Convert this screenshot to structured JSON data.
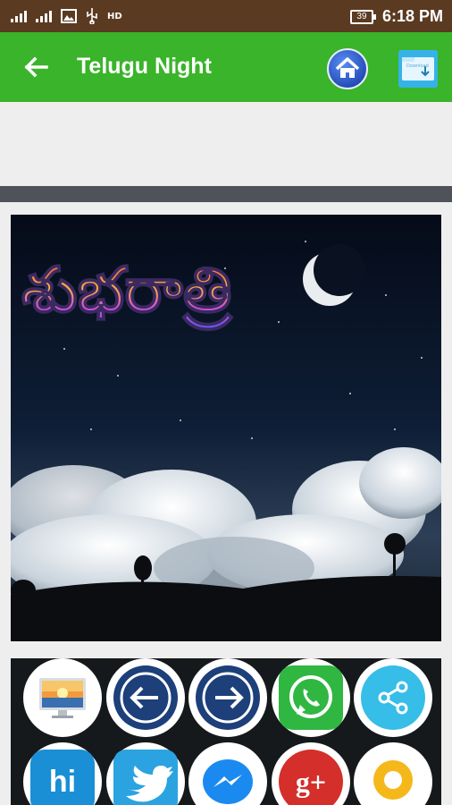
{
  "status_bar": {
    "hd_label": "HD",
    "battery": "39",
    "time": "6:18 PM"
  },
  "app_bar": {
    "title": "Telugu Night",
    "back_icon": "arrow-left-icon",
    "home_icon": "home-icon",
    "download_icon": "download-folder-icon",
    "download_caption": "Download"
  },
  "image": {
    "overlay_text": "శుభరాత్రి",
    "description_icons": [
      "crescent-moon",
      "clouds",
      "trees"
    ]
  },
  "share_buttons": [
    {
      "name": "set-wallpaper",
      "icon": "monitor-sunset-icon"
    },
    {
      "name": "previous",
      "icon": "arrow-left-circle-icon"
    },
    {
      "name": "next",
      "icon": "arrow-right-circle-icon"
    },
    {
      "name": "whatsapp",
      "icon": "whatsapp-icon"
    },
    {
      "name": "share",
      "icon": "share-icon"
    },
    {
      "name": "hike",
      "icon": "hike-icon",
      "label": "hi"
    },
    {
      "name": "twitter",
      "icon": "twitter-icon"
    },
    {
      "name": "messenger",
      "icon": "messenger-icon"
    },
    {
      "name": "google-plus",
      "icon": "google-plus-icon",
      "label": "g+"
    },
    {
      "name": "allo",
      "icon": "allo-icon"
    }
  ],
  "colors": {
    "status_bar": "#5b3a22",
    "app_bar": "#3ab42a",
    "divider": "#4d5358",
    "panel": "#16191c"
  }
}
